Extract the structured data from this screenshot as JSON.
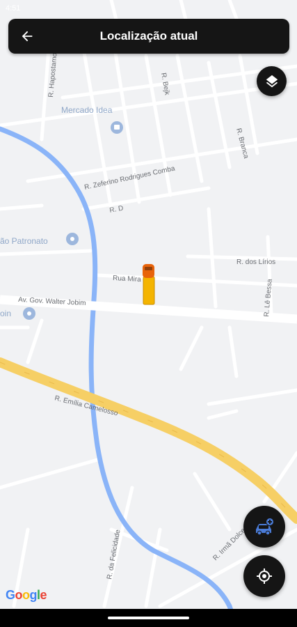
{
  "status_bar": {
    "time": "4:51"
  },
  "app_bar": {
    "title": "Localização atual"
  },
  "map": {
    "streets": {
      "hapostamo": "R. Hapostamo",
      "bejk": "R. Bejk",
      "branca": "R. Branca",
      "zeferino": "R. Zeferino Rodrigues Comba",
      "rd": "R. D",
      "lirios": "R. dos Lírios",
      "mira": "Rua Mira",
      "bessa": "R. Lê Bessa",
      "walter": "Av. Gov. Walter Jobim",
      "emilia": "R. Emília Camelosso",
      "felicidade": "R. da Felicidade",
      "irma": "R. Irmã Dolce"
    },
    "pois": {
      "mercado": "Mercado Idea",
      "patronato": "ão Patronato",
      "oin": "oin"
    }
  },
  "branding": {
    "google": [
      {
        "ch": "G",
        "color": "#4285F4"
      },
      {
        "ch": "o",
        "color": "#EA4335"
      },
      {
        "ch": "o",
        "color": "#FBBC05"
      },
      {
        "ch": "g",
        "color": "#4285F4"
      },
      {
        "ch": "l",
        "color": "#34A853"
      },
      {
        "ch": "e",
        "color": "#EA4335"
      }
    ]
  },
  "icons": {
    "back": "arrow-left-icon",
    "layers": "layers-icon",
    "add_vehicle": "car-plus-icon",
    "locate": "crosshair-icon"
  },
  "colors": {
    "app_bar": "#151515",
    "map_bg": "#f1f2f4",
    "river": "#8ab4f8",
    "highway": "#f6cf65",
    "accent_blue": "#4a7bd6",
    "vehicle_body": "#f4b400",
    "vehicle_cab": "#e8630a"
  }
}
